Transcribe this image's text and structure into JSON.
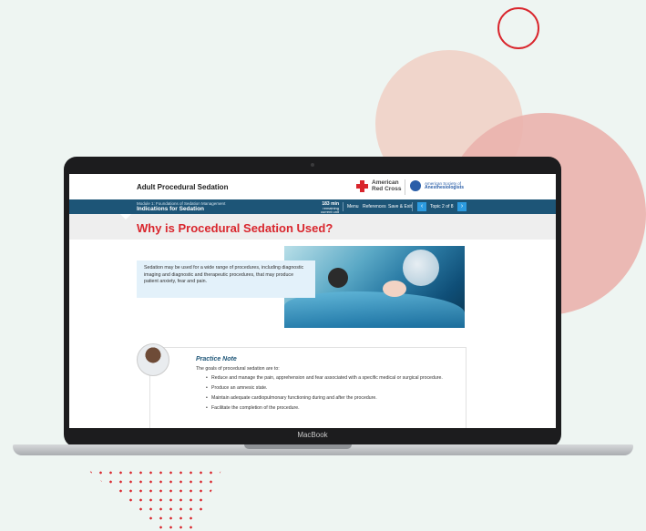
{
  "colors": {
    "accent_red": "#d9262d",
    "navy": "#1d5577",
    "arrow_blue": "#2c9be0",
    "background": "#eef5f2"
  },
  "laptop": {
    "brand_label": "MacBook"
  },
  "app": {
    "title": "Adult Procedural Sedation",
    "logos": {
      "arc_line1": "American",
      "arc_line2": "Red Cross",
      "asa_line1": "American Society of",
      "asa_line2": "Anesthesiologists"
    }
  },
  "nav": {
    "module": "Module 1: Foundations of Sedation Management",
    "lesson": "Indications for Sedation",
    "remaining_value": "183 min",
    "remaining_label": "remaining",
    "remaining_sub": "current unit",
    "menu": "Menu",
    "references": "References",
    "save_exit": "Save & Exit",
    "prev_icon": "chevron-left-icon",
    "next_icon": "chevron-right-icon",
    "topic_counter": "Topic 2 of 8"
  },
  "content": {
    "headline": "Why is Procedural Sedation Used?",
    "intro": "Sedation may be used for a wide range of procedures, including diagnostic imaging and diagnostic and therapeutic procedures, that may produce patient anxiety, fear and pain.",
    "practice_note": {
      "title": "Practice Note",
      "intro": "The goals of procedural sedation are to:",
      "items": [
        "Reduce and manage the pain, apprehension and fear associated with a specific medical or surgical procedure.",
        "Produce an amnesic state.",
        "Maintain adequate cardiopulmonary functioning during and after the procedure.",
        "Facilitate the completion of the procedure."
      ]
    }
  }
}
